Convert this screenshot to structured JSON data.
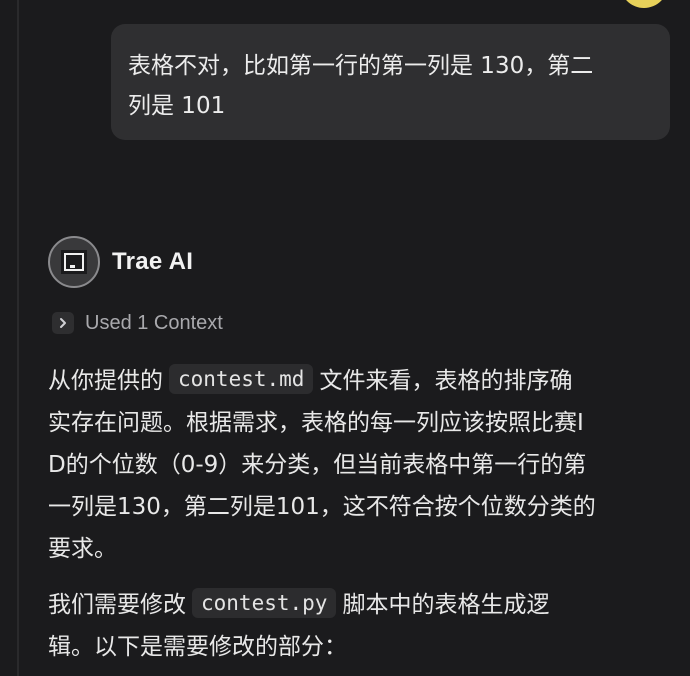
{
  "user_message": {
    "line1": "表格不对，比如第一行的第一列是 130，第二",
    "line2": "列是 101"
  },
  "assistant": {
    "name": "Trae AI",
    "context_label": "Used 1 Context",
    "para1": {
      "part1": "从你提供的",
      "code": "contest.md",
      "part2": "文件来看，表格的排序确",
      "line2": "实存在问题。根据需求，表格的每一列应该按照比赛I",
      "line3": "D的个位数（0-9）来分类，但当前表格中第一行的第",
      "line4": "一列是130，第二列是101，这不符合按个位数分类的",
      "line5": "要求。"
    },
    "para2": {
      "part1": "我们需要修改",
      "code": "contest.py",
      "part2": "脚本中的表格生成逻",
      "line2": "辑。以下是需要修改的部分："
    }
  },
  "icons": {
    "avatar": "trae-logo-icon",
    "context_toggle": "chevron-right-icon"
  },
  "colors": {
    "background": "#1b1b1d",
    "user_bubble": "#2f2f31",
    "code_bg": "#2c2c2e",
    "user_avatar": "#e7d15a"
  }
}
